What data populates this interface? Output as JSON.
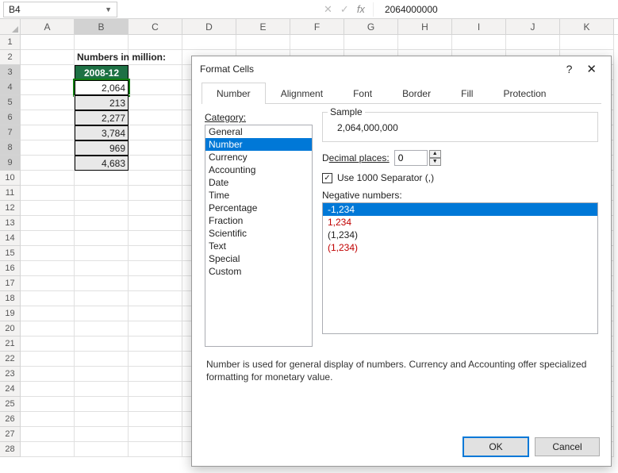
{
  "namebox": {
    "ref": "B4"
  },
  "formula": {
    "value": "2064000000"
  },
  "columns": [
    "A",
    "B",
    "C",
    "D",
    "E",
    "F",
    "G",
    "H",
    "I",
    "J",
    "K"
  ],
  "selected_column": "B",
  "rows": {
    "count": 28,
    "selected": [
      3,
      4,
      5,
      6,
      7,
      8,
      9
    ]
  },
  "sheet": {
    "title_cell": {
      "row": 2,
      "col": "B",
      "text": "Numbers in million:"
    },
    "header_cell": {
      "row": 3,
      "col": "B",
      "text": "2008-12"
    },
    "data": [
      {
        "row": 4,
        "col": "B",
        "text": "2,064",
        "active": true
      },
      {
        "row": 5,
        "col": "B",
        "text": "213"
      },
      {
        "row": 6,
        "col": "B",
        "text": "2,277"
      },
      {
        "row": 7,
        "col": "B",
        "text": "3,784"
      },
      {
        "row": 8,
        "col": "B",
        "text": "969"
      },
      {
        "row": 9,
        "col": "B",
        "text": "4,683"
      }
    ]
  },
  "dialog": {
    "title": "Format Cells",
    "tabs": [
      "Number",
      "Alignment",
      "Font",
      "Border",
      "Fill",
      "Protection"
    ],
    "active_tab": "Number",
    "category_label": "Category:",
    "categories": [
      "General",
      "Number",
      "Currency",
      "Accounting",
      "Date",
      "Time",
      "Percentage",
      "Fraction",
      "Scientific",
      "Text",
      "Special",
      "Custom"
    ],
    "selected_category": "Number",
    "sample_label": "Sample",
    "sample_value": "2,064,000,000",
    "decimal_label_pre": "D",
    "decimal_label_u": "ecimal places:",
    "decimal_value": "0",
    "sep_label_pre": "U",
    "sep_label_rest": "se 1000 Separator (,)",
    "sep_checked": true,
    "neg_label_pre": "N",
    "neg_label_rest": "egative numbers:",
    "neg_options": [
      {
        "text": "-1,234",
        "style": "normal"
      },
      {
        "text": "1,234",
        "style": "red"
      },
      {
        "text": "(1,234)",
        "style": "normal"
      },
      {
        "text": "(1,234)",
        "style": "red"
      }
    ],
    "selected_neg": 0,
    "description": "Number is used for general display of numbers.  Currency and Accounting offer specialized formatting for monetary value.",
    "ok": "OK",
    "cancel": "Cancel"
  }
}
